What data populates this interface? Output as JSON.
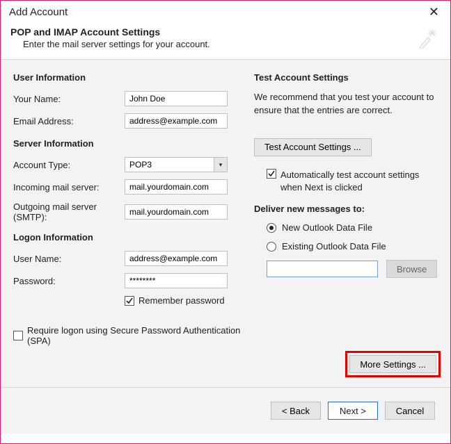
{
  "window": {
    "title": "Add Account"
  },
  "header": {
    "title": "POP and IMAP Account Settings",
    "subtitle": "Enter the mail server settings for your account."
  },
  "left": {
    "user_info_title": "User Information",
    "your_name_label": "Your Name:",
    "your_name_value": "John Doe",
    "email_label": "Email Address:",
    "email_value": "address@example.com",
    "server_info_title": "Server Information",
    "account_type_label": "Account Type:",
    "account_type_value": "POP3",
    "incoming_label": "Incoming mail server:",
    "incoming_value": "mail.yourdomain.com",
    "outgoing_label": "Outgoing mail server (SMTP):",
    "outgoing_value": "mail.yourdomain.com",
    "logon_info_title": "Logon Information",
    "username_label": "User Name:",
    "username_value": "address@example.com",
    "password_label": "Password:",
    "password_value": "********",
    "remember_pw_label": "Remember password",
    "remember_pw_checked": true,
    "spa_label": "Require logon using Secure Password Authentication (SPA)",
    "spa_checked": false
  },
  "right": {
    "title": "Test Account Settings",
    "desc": "We recommend that you test your account to ensure that the entries are correct.",
    "test_btn": "Test Account Settings ...",
    "auto_test_label": "Automatically test account settings when Next is clicked",
    "auto_test_checked": true,
    "deliver_title": "Deliver new messages to:",
    "new_datafile_label": "New Outlook Data File",
    "existing_datafile_label": "Existing Outlook Data File",
    "datafile_selected": "new",
    "datafile_path": "",
    "browse_btn": "Browse",
    "more_settings_btn": "More Settings ..."
  },
  "footer": {
    "back": "< Back",
    "next": "Next >",
    "cancel": "Cancel"
  }
}
